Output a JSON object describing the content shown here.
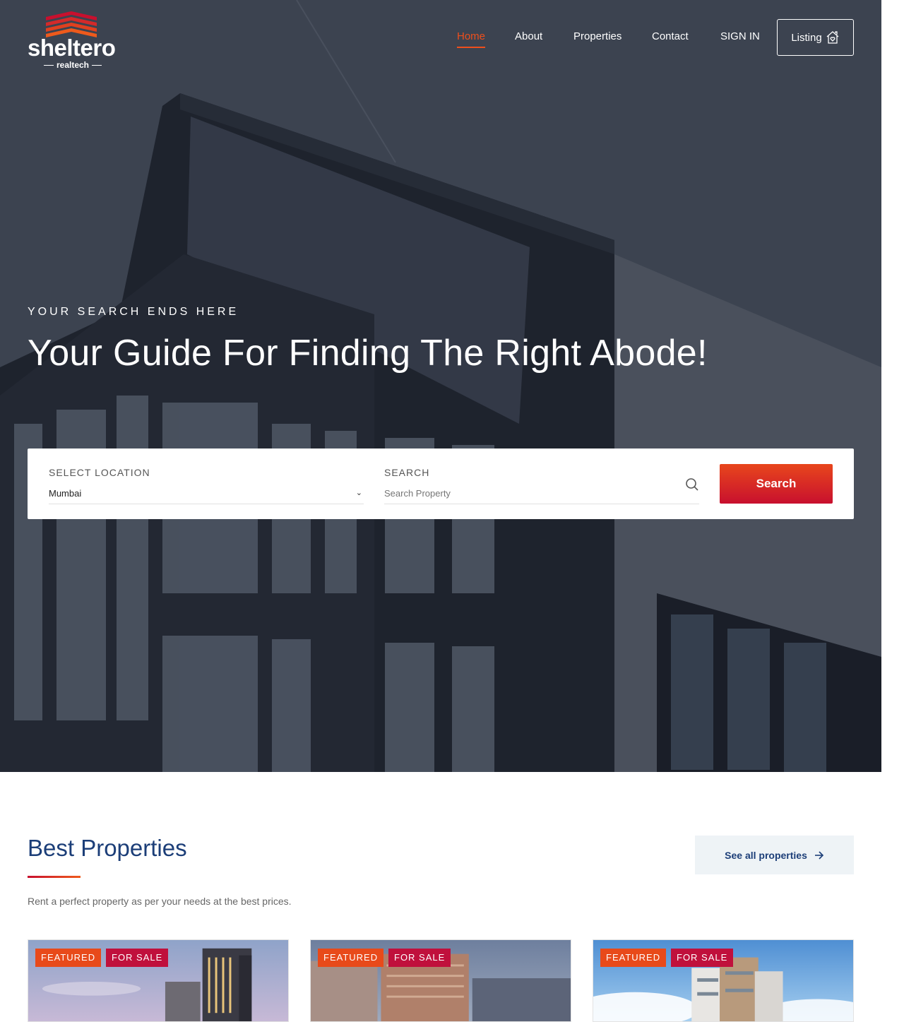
{
  "brand": {
    "name": "sheltero",
    "tagline": "realtech"
  },
  "nav": {
    "items": [
      {
        "label": "Home",
        "active": true
      },
      {
        "label": "About",
        "active": false
      },
      {
        "label": "Properties",
        "active": false
      },
      {
        "label": "Contact",
        "active": false
      },
      {
        "label": "SIGN IN",
        "active": false
      }
    ],
    "listing_label": "Listing"
  },
  "hero": {
    "kicker": "YOUR SEARCH ENDS HERE",
    "headline": "Your Guide For Finding The Right Abode!"
  },
  "search": {
    "location_label": "SELECT LOCATION",
    "location_value": "Mumbai",
    "search_label": "SEARCH",
    "search_placeholder": "Search Property",
    "button_label": "Search"
  },
  "best_properties": {
    "title": "Best Properties",
    "description": "Rent a perfect property as per your needs at the best prices.",
    "see_all_label": "See all properties",
    "cards": [
      {
        "badge_featured": "FEATURED",
        "badge_status": "FOR SALE"
      },
      {
        "badge_featured": "FEATURED",
        "badge_status": "FOR SALE"
      },
      {
        "badge_featured": "FEATURED",
        "badge_status": "FOR SALE"
      }
    ]
  },
  "colors": {
    "accent": "#ee4f1c",
    "brand_red": "#c8102e",
    "heading_blue": "#1c3e78"
  },
  "icons": [
    "house-heart-icon",
    "search-icon",
    "chevron-down-icon",
    "arrow-right-icon"
  ]
}
